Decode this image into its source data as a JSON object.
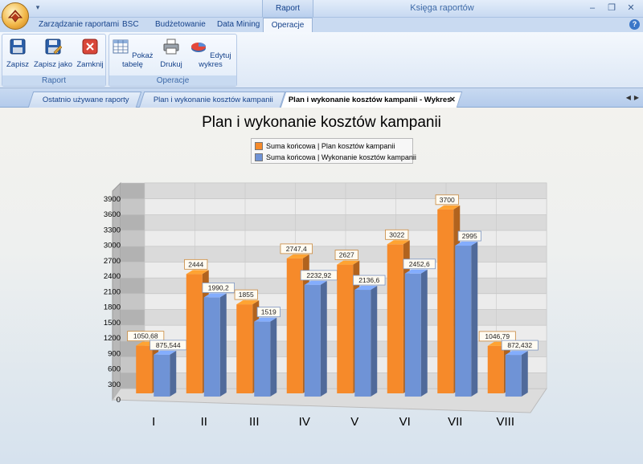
{
  "window": {
    "title": "Księga raportów",
    "context_tab": "Raport",
    "qat_symbol": "▾",
    "minimize": "–",
    "restore": "❐",
    "close": "✕",
    "help": "?"
  },
  "ribbon_tabs": [
    {
      "label": "Zarządzanie raportami"
    },
    {
      "label": "BSC"
    },
    {
      "label": "Budżetowanie"
    },
    {
      "label": "Data Mining"
    },
    {
      "label": "Operacje",
      "active": true
    }
  ],
  "ribbon_groups": {
    "raport": {
      "label": "Raport",
      "buttons": [
        {
          "label": "Zapisz",
          "icon": "floppy-disk-icon"
        },
        {
          "label": "Zapisz jako",
          "icon": "floppy-save-as-icon"
        },
        {
          "label": "Zamknij",
          "icon": "close-red-icon"
        }
      ]
    },
    "operacje": {
      "label": "Operacje",
      "buttons": [
        {
          "label": "Pokaż tabelę",
          "icon": "table-icon"
        },
        {
          "label": "Drukuj",
          "icon": "printer-icon"
        },
        {
          "label": "Edytuj wykres",
          "icon": "pie-chart-icon"
        }
      ]
    }
  },
  "doc_tabs": [
    {
      "label": "Ostatnio używane raporty"
    },
    {
      "label": "Plan i wykonanie kosztów kampanii"
    },
    {
      "label": "Plan i wykonanie kosztów kampanii - Wykres",
      "active": true,
      "close": "✕"
    }
  ],
  "doc_tab_arrows": {
    "left": "◀",
    "right": "▶"
  },
  "chart_data": {
    "type": "bar",
    "title": "Plan i wykonanie kosztów kampanii",
    "categories": [
      "I",
      "II",
      "III",
      "IV",
      "V",
      "VI",
      "VII",
      "VIII"
    ],
    "series": [
      {
        "name": "Suma końcowa | Plan kosztów kampanii",
        "color": "#f68a2a",
        "values": [
          1050.68,
          2444,
          1855,
          2747.4,
          2627,
          3022,
          3700,
          1046.79
        ],
        "labels": [
          "1050,68",
          "2444",
          "1855",
          "2747,4",
          "2627",
          "3022",
          "3700",
          "1046,79"
        ]
      },
      {
        "name": "Suma końcowa | Wykonanie kosztów kampanii",
        "color": "#6f93d6",
        "values": [
          875.544,
          1990.2,
          1519,
          2232.92,
          2136.6,
          2452.6,
          2995,
          872.432
        ],
        "labels": [
          "875,544",
          "1990,2",
          "1519",
          "2232,92",
          "2136,6",
          "2452,6",
          "2995",
          "872,432"
        ]
      }
    ],
    "y_ticks": [
      "0",
      "300",
      "600",
      "900",
      "1200",
      "1500",
      "1800",
      "2100",
      "2400",
      "2700",
      "3000",
      "3300",
      "3600",
      "3900"
    ],
    "ylim": [
      0,
      3900
    ],
    "legend_position": "top-center",
    "grid": true,
    "style": "3d"
  }
}
